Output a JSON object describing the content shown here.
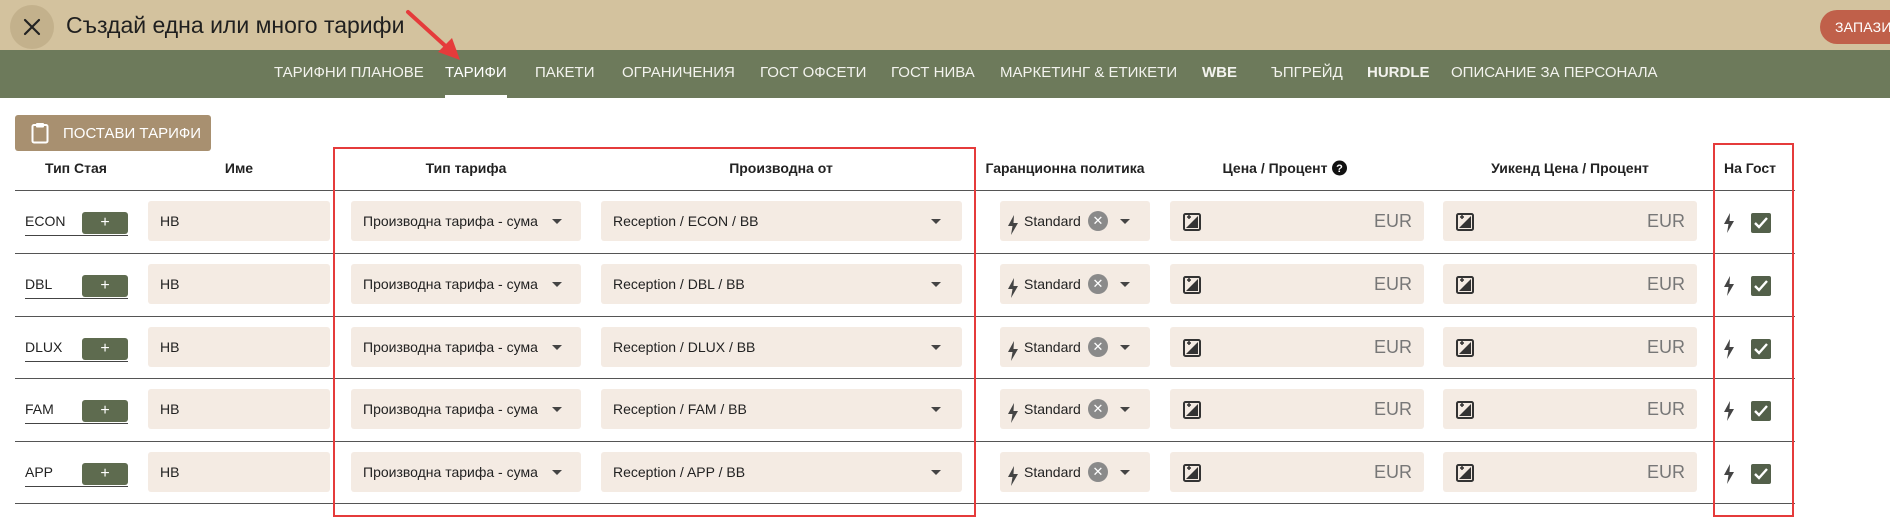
{
  "header": {
    "title": "Създай една или много тарифи",
    "save_label": "ЗАПАЗИ"
  },
  "nav": {
    "tabs": [
      {
        "label": "ТАРИФНИ ПЛАНОВЕ",
        "active": false,
        "bold": false
      },
      {
        "label": "ТАРИФИ",
        "active": true,
        "bold": false
      },
      {
        "label": "ПАКЕТИ",
        "active": false,
        "bold": false
      },
      {
        "label": "ОГРАНИЧЕНИЯ",
        "active": false,
        "bold": false
      },
      {
        "label": "ГОСТ ОФСЕТИ",
        "active": false,
        "bold": false
      },
      {
        "label": "ГОСТ НИВА",
        "active": false,
        "bold": false
      },
      {
        "label": "МАРКЕТИНГ & ЕТИКЕТИ",
        "active": false,
        "bold": false
      },
      {
        "label": "WBE",
        "active": false,
        "bold": true
      },
      {
        "label": "ЪПГРЕЙД",
        "active": false,
        "bold": false
      },
      {
        "label": "HURDLE",
        "active": false,
        "bold": true
      },
      {
        "label": "ОПИСАНИЕ ЗА ПЕРСОНАЛА",
        "active": false,
        "bold": false
      }
    ]
  },
  "toolbar": {
    "paste_label": "ПОСТАВИ ТАРИФИ"
  },
  "table": {
    "columns": {
      "room_type": "Тип Стая",
      "name": "Име",
      "rate_type": "Тип тарифа",
      "derived_from": "Производна от",
      "guarantee_policy": "Гаранционна политика",
      "price": "Цена / Процент",
      "weekend_price": "Уикенд Цена / Процент",
      "on_guest": "На Гост"
    },
    "rows": [
      {
        "room": "ECON",
        "add": "+",
        "name": "НВ",
        "rate_type": "Производна тарифа - сума",
        "derived_from": "Reception / ECON / BB",
        "policy": "Standard",
        "currency": "EUR",
        "weekend_currency": "EUR"
      },
      {
        "room": "DBL",
        "add": "+",
        "name": "НВ",
        "rate_type": "Производна тарифа - сума",
        "derived_from": "Reception / DBL / BB",
        "policy": "Standard",
        "currency": "EUR",
        "weekend_currency": "EUR"
      },
      {
        "room": "DLUX",
        "add": "+",
        "name": "НВ",
        "rate_type": "Производна тарифа - сума",
        "derived_from": "Reception / DLUX / BB",
        "policy": "Standard",
        "currency": "EUR",
        "weekend_currency": "EUR"
      },
      {
        "room": "FAM",
        "add": "+",
        "name": "НВ",
        "rate_type": "Производна тарифа - сума",
        "derived_from": "Reception / FAM / BB",
        "policy": "Standard",
        "currency": "EUR",
        "weekend_currency": "EUR"
      },
      {
        "room": "APP",
        "add": "+",
        "name": "НВ",
        "rate_type": "Производна тарифа - сума",
        "derived_from": "Reception / APP / BB",
        "policy": "Standard",
        "currency": "EUR",
        "weekend_currency": "EUR"
      }
    ]
  },
  "colors": {
    "topbar": "#d3c29e",
    "navbar": "#6d7a5b",
    "accent": "#c0604a",
    "field_bg": "#f4ebe3",
    "annotation": "#e53b3b"
  },
  "icons": {
    "close": "close-icon",
    "paste": "clipboard-icon",
    "help": "help-circle-icon",
    "bolt": "bolt-icon",
    "image": "image-edit-icon",
    "checkbox": "checkbox-checked-icon",
    "clear": "clear-icon",
    "dropdown": "chevron-down-icon"
  }
}
